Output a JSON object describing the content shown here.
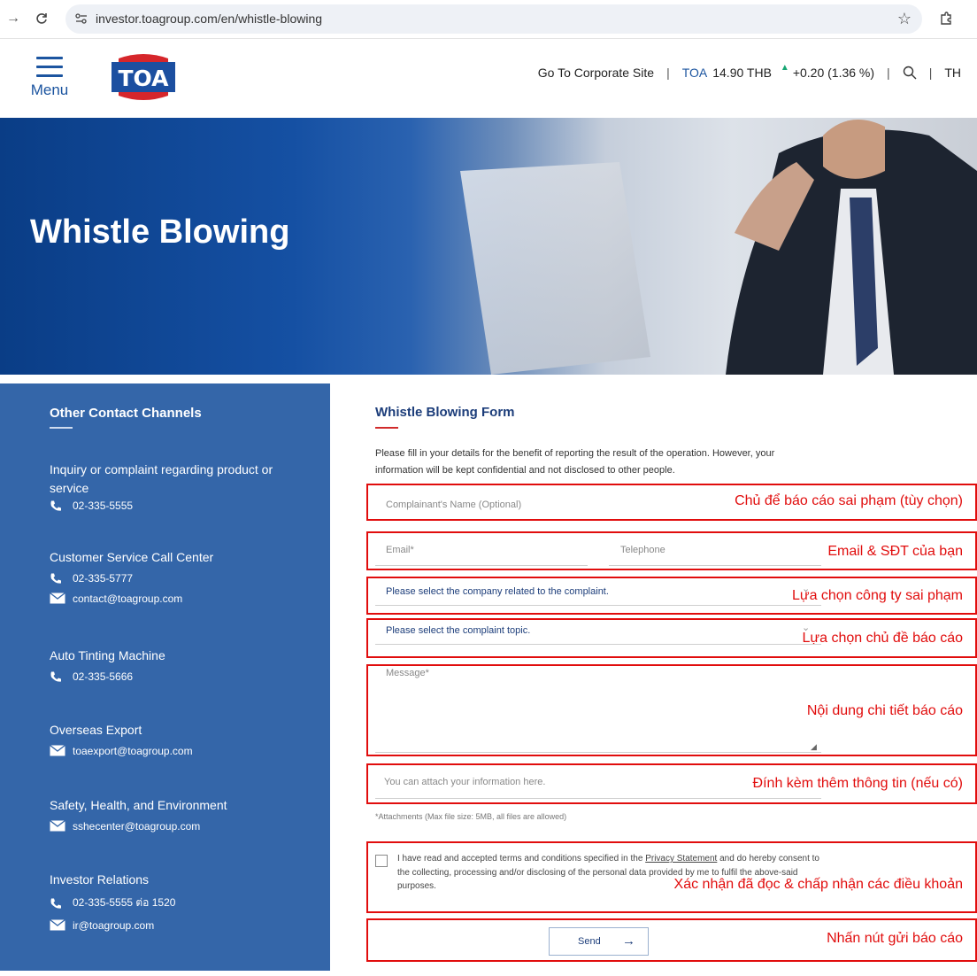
{
  "browser": {
    "url": "investor.toagroup.com/en/whistle-blowing"
  },
  "header": {
    "menu_label": "Menu",
    "logo_text": "TOA",
    "corporate_link": "Go To Corporate Site",
    "stock_symbol": "TOA",
    "stock_price": "14.90 THB",
    "stock_change": "+0.20 (1.36 %)",
    "language": "TH"
  },
  "hero": {
    "title": "Whistle Blowing"
  },
  "sidebar": {
    "title": "Other Contact Channels",
    "groups": [
      {
        "title": "Inquiry or complaint regarding product or service",
        "phone": "02-335-5555"
      },
      {
        "title": "Customer Service Call Center",
        "phone": "02-335-5777",
        "email": "contact@toagroup.com"
      },
      {
        "title": "Auto Tinting Machine",
        "phone": "02-335-5666"
      },
      {
        "title": "Overseas Export",
        "email": "toaexport@toagroup.com"
      },
      {
        "title": "Safety, Health, and Environment",
        "email": "sshecenter@toagroup.com"
      },
      {
        "title": "Investor Relations",
        "phone": "02-335-5555 ต่อ 1520",
        "email": "ir@toagroup.com"
      }
    ]
  },
  "form": {
    "title": "Whistle Blowing Form",
    "description": "Please fill in your details for the benefit of reporting the result of the operation. However, your information will be kept confidential and not disclosed to other people.",
    "name_placeholder": "Complainant's Name (Optional)",
    "email_placeholder": "Email*",
    "telephone_placeholder": "Telephone",
    "company_select": "Please select the company related to the complaint.",
    "topic_select": "Please select the complaint topic.",
    "message_placeholder": "Message*",
    "attach_placeholder": "You can attach your information here.",
    "attach_note": "*Attachments (Max file size: 5MB, all files are allowed)",
    "consent_before": "I have read and accepted terms and conditions specified in the ",
    "consent_link": "Privacy Statement",
    "consent_after": " and do hereby consent to the collecting, processing and/or disclosing of the personal data provided by me to fulfil the above-said purposes.",
    "send_label": "Send"
  },
  "annotations": {
    "name": "Chủ để báo cáo sai phạm (tùy chọn)",
    "contact": "Email & SĐT của bạn",
    "company": "Lựa chọn công ty sai phạm",
    "topic": "Lựa chọn chủ đề báo cáo",
    "message": "Nội dung chi tiết báo cáo",
    "attach": "Đính kèm thêm thông tin (nếu có)",
    "consent": "Xác nhận đã đọc & chấp nhận các điều khoản",
    "send": "Nhấn nút gửi báo cáo"
  },
  "colors": {
    "brand_blue": "#1c55a0",
    "sidebar_blue": "#3466a9",
    "annotation_red": "#e10d0d",
    "stock_up": "#17a673",
    "logo_red": "#d6262b"
  },
  "icons": [
    "back-arrow-icon",
    "reload-icon",
    "site-settings-icon",
    "bookmark-star-icon",
    "extensions-icon",
    "hamburger-icon",
    "search-icon",
    "up-triangle-icon",
    "phone-icon",
    "mail-icon",
    "chevron-down-icon",
    "arrow-right-icon",
    "resize-handle-icon"
  ]
}
